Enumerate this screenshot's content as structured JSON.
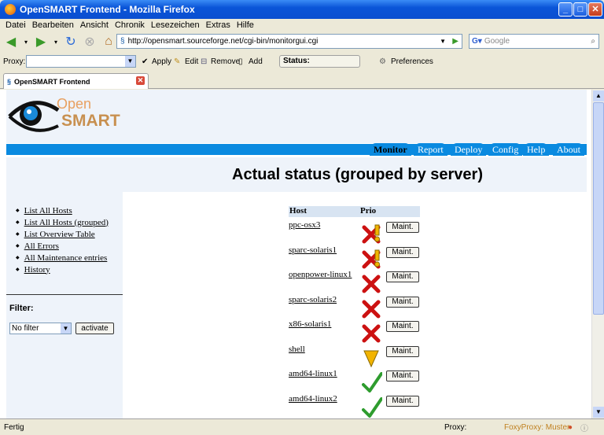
{
  "window": {
    "title": "OpenSMART Frontend - Mozilla Firefox"
  },
  "menu": [
    "Datei",
    "Bearbeiten",
    "Ansicht",
    "Chronik",
    "Lesezeichen",
    "Extras",
    "Hilfe"
  ],
  "nav": {
    "url": "http://opensmart.sourceforge.net/cgi-bin/monitorgui.cgi",
    "search_placeholder": "Google"
  },
  "proxy": {
    "label": "Proxy:",
    "apply": "Apply",
    "edit": "Edit",
    "remove": "Remove",
    "add": "Add",
    "status": "Status:",
    "preferences": "Preferences"
  },
  "tab": {
    "title": "OpenSMART Frontend"
  },
  "logo": {
    "line1": "Open",
    "line2": "SMART"
  },
  "navtabs": [
    "Monitor",
    "Report",
    "Deploy",
    "Config",
    "Help",
    "About"
  ],
  "page": {
    "title": "Actual status (grouped by server)"
  },
  "sidebar": {
    "links": [
      "List All Hosts",
      "List All Hosts (grouped)",
      "List Overview Table",
      "All Errors",
      "All Maintenance entries",
      "History"
    ],
    "filter_label": "Filter:",
    "filter_value": "No filter",
    "activate": "activate"
  },
  "table": {
    "col_host": "Host",
    "col_prio": "Prio",
    "maint_label": "Maint.",
    "rows": [
      {
        "host": "ppc-osx3",
        "status": "error-warning"
      },
      {
        "host": "sparc-solaris1",
        "status": "error-warning"
      },
      {
        "host": "openpower-linux1",
        "status": "error"
      },
      {
        "host": "sparc-solaris2",
        "status": "error"
      },
      {
        "host": "x86-solaris1",
        "status": "error"
      },
      {
        "host": "shell",
        "status": "warning"
      },
      {
        "host": "amd64-linux1",
        "status": "ok"
      },
      {
        "host": "amd64-linux2",
        "status": "ok"
      }
    ]
  },
  "statusbar": {
    "left": "Fertig",
    "proxy": "Proxy:",
    "foxy": "FoxyProxy: Muster"
  },
  "colors": {
    "accent": "#0a8ae0",
    "error": "#cc1111",
    "warning": "#f2b400",
    "ok": "#2e9c2e"
  }
}
